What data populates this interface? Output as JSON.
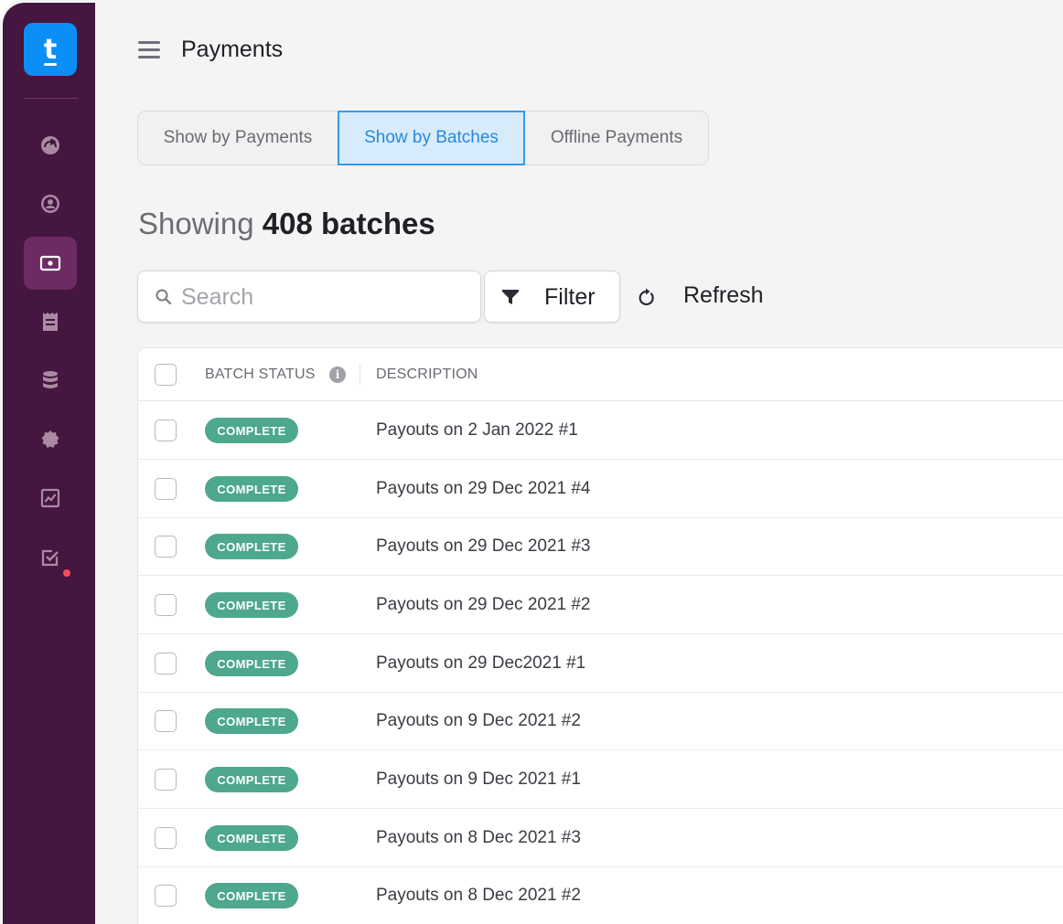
{
  "app": {
    "logo_letter": "t"
  },
  "header": {
    "title": "Payments"
  },
  "tabs": [
    {
      "label": "Show by Payments",
      "active": false
    },
    {
      "label": "Show by Batches",
      "active": true
    },
    {
      "label": "Offline Payments",
      "active": false
    }
  ],
  "summary": {
    "prefix": "Showing",
    "count_text": "408 batches"
  },
  "toolbar": {
    "search_placeholder": "Search",
    "filter_label": "Filter",
    "refresh_label": "Refresh"
  },
  "table": {
    "columns": [
      "BATCH STATUS",
      "DESCRIPTION"
    ],
    "info_glyph": "i",
    "rows": [
      {
        "status": "COMPLETE",
        "description": "Payouts on 2 Jan 2022 #1"
      },
      {
        "status": "COMPLETE",
        "description": "Payouts on 29 Dec 2021 #4"
      },
      {
        "status": "COMPLETE",
        "description": "Payouts on 29 Dec 2021 #3"
      },
      {
        "status": "COMPLETE",
        "description": "Payouts on 29 Dec 2021 #2"
      },
      {
        "status": "COMPLETE",
        "description": "Payouts on 29 Dec2021 #1"
      },
      {
        "status": "COMPLETE",
        "description": "Payouts on 9 Dec 2021 #2"
      },
      {
        "status": "COMPLETE",
        "description": "Payouts on 9 Dec 2021 #1"
      },
      {
        "status": "COMPLETE",
        "description": "Payouts on 8 Dec 2021 #3"
      },
      {
        "status": "COMPLETE",
        "description": "Payouts on 8 Dec 2021 #2"
      }
    ]
  },
  "sidebar": {
    "items": [
      {
        "icon": "dashboard-icon",
        "active": false
      },
      {
        "icon": "user-icon",
        "active": false
      },
      {
        "icon": "payments-icon",
        "active": true
      },
      {
        "icon": "receipt-icon",
        "active": false
      },
      {
        "icon": "database-icon",
        "active": false
      },
      {
        "icon": "badge-icon",
        "active": false
      },
      {
        "icon": "chart-icon",
        "active": false
      },
      {
        "icon": "tasks-icon",
        "active": false,
        "notification": true
      }
    ]
  },
  "colors": {
    "sidebar_bg": "#45163f",
    "sidebar_active": "#6c2b63",
    "logo_bg": "#0b8ff7",
    "tab_active_border": "#3a98e6",
    "tab_active_bg": "#d6ecfc",
    "badge_complete": "#4da88d",
    "notification_dot": "#ff4d5a"
  }
}
